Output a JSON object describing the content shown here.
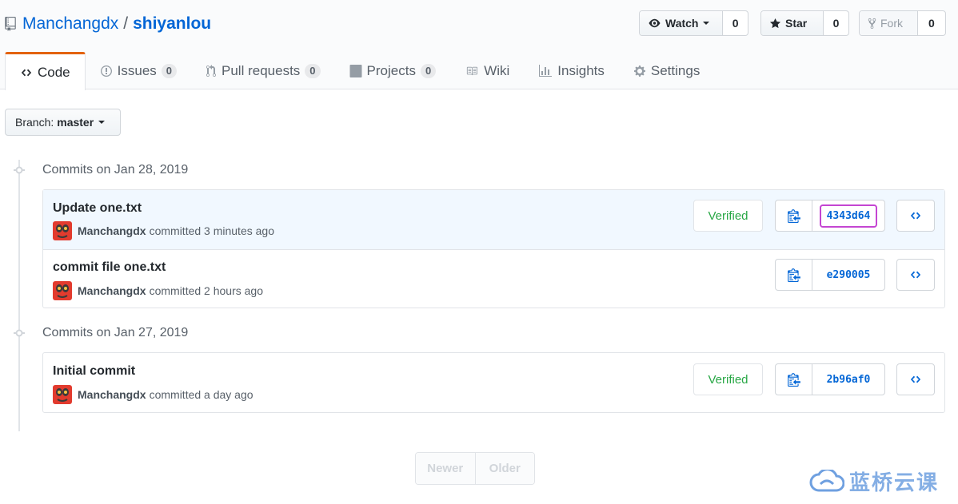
{
  "repo": {
    "owner": "Manchangdx",
    "separator": "/",
    "name": "shiyanlou"
  },
  "actions": {
    "watch": {
      "label": "Watch",
      "count": "0"
    },
    "star": {
      "label": "Star",
      "count": "0"
    },
    "fork": {
      "label": "Fork",
      "count": "0"
    }
  },
  "tabs": [
    {
      "label": "Code",
      "icon": "code-icon"
    },
    {
      "label": "Issues",
      "icon": "issue-icon",
      "count": "0"
    },
    {
      "label": "Pull requests",
      "icon": "pull-request-icon",
      "count": "0"
    },
    {
      "label": "Projects",
      "icon": "project-icon",
      "count": "0"
    },
    {
      "label": "Wiki",
      "icon": "book-icon"
    },
    {
      "label": "Insights",
      "icon": "graph-icon"
    },
    {
      "label": "Settings",
      "icon": "gear-icon"
    }
  ],
  "branch": {
    "prefix": "Branch:",
    "name": "master"
  },
  "groups": [
    {
      "title": "Commits on Jan 28, 2019",
      "commits": [
        {
          "message": "Update one.txt",
          "author": "Manchangdx",
          "time": "committed 3 minutes ago",
          "verified": "Verified",
          "sha": "4343d64"
        },
        {
          "message": "commit file one.txt",
          "author": "Manchangdx",
          "time": "committed 2 hours ago",
          "sha": "e290005"
        }
      ]
    },
    {
      "title": "Commits on Jan 27, 2019",
      "commits": [
        {
          "message": "Initial commit",
          "author": "Manchangdx",
          "time": "committed a day ago",
          "verified": "Verified",
          "sha": "2b96af0"
        }
      ]
    }
  ],
  "pagination": {
    "newer": "Newer",
    "older": "Older"
  },
  "watermark": {
    "text": "蓝桥云课"
  },
  "colors": {
    "link": "#0366d6",
    "verified": "#28a745",
    "tab_accent": "#e36209",
    "sha_highlight": "#c445d2"
  }
}
